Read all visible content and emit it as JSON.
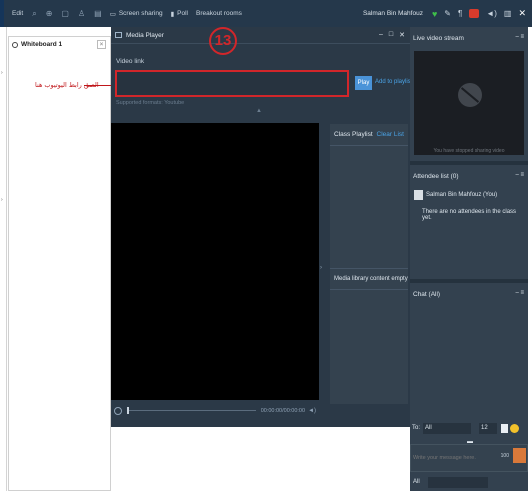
{
  "toolbar": {
    "edit": "Edit",
    "screen_sharing": "Screen sharing",
    "poll": "Poll",
    "breakout_rooms": "Breakout rooms",
    "user_name": "Salman Bin Mahfouz"
  },
  "whiteboard": {
    "title": "Whiteboard 1",
    "annotation": "الصق رابط اليوتيوب هنا"
  },
  "media_player": {
    "title": "Media Player",
    "step_number": "13",
    "video_link_label": "Video link",
    "video_link_value": "",
    "play_label": "Play",
    "add_to_playlist_label": "Add to playlist",
    "supported_formats": "Supported formats: Youtube",
    "time_display": "00:00:00/00:00:00",
    "progress": 0,
    "class_playlist_label": "Class Playlist",
    "clear_list_label": "Clear List",
    "media_library_label": "Media library content empty"
  },
  "right_panel": {
    "live_video_title": "Live video stream",
    "video_stopped_text": "You have stopped sharing video",
    "attendee_title": "Attendee list (0)",
    "attendee_self": "Salman Bin Mahfouz (You)",
    "no_attendees_text": "There are no attendees in the class yet.",
    "chat_title": "Chat (All)",
    "to_label": "To:",
    "to_value": "All",
    "font_size": "12",
    "message_placeholder": "Write your message here.",
    "send_hint": "100",
    "all_label": "All"
  },
  "colors": {
    "toolbar_bg": "#25384b",
    "panel_bg": "#2b3947",
    "highlight_red": "#d2262a",
    "accent_blue": "#4a93d8"
  }
}
